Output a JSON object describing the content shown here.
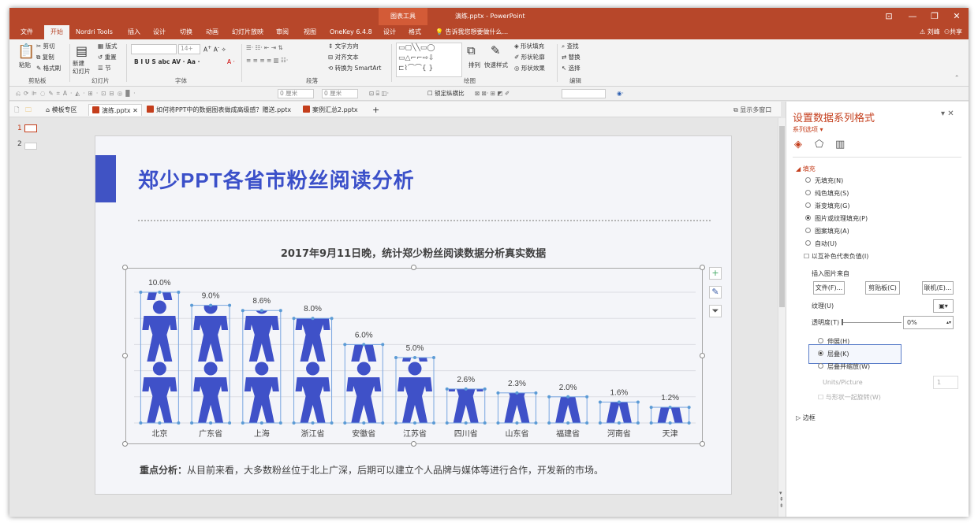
{
  "window": {
    "context_tab_group": "图表工具",
    "doc_title": "演练.pptx - PowerPoint",
    "controls": [
      "⊡",
      "—",
      "❐",
      "✕"
    ]
  },
  "ribbon_tabs": [
    "文件",
    "开始",
    "Nordri Tools",
    "插入",
    "设计",
    "切换",
    "动画",
    "幻灯片放映",
    "审阅",
    "视图",
    "OneKey 6.4.8",
    "设计",
    "格式"
  ],
  "tell_me": "告诉我您想要做什么...",
  "user": {
    "name": "刘峰",
    "share": "共享"
  },
  "ribbon": {
    "clipboard": {
      "paste": "粘贴",
      "cut": "剪切",
      "copy": "复制",
      "format_painter": "格式刷",
      "group": "剪贴板"
    },
    "slides": {
      "new_slide": "新建\n幻灯片",
      "layout": "版式",
      "reset": "重置",
      "section": "节",
      "group": "幻灯片"
    },
    "font": {
      "size": "14+",
      "group": "字体"
    },
    "paragraph": {
      "text_direction": "文字方向",
      "align_text": "对齐文本",
      "smartart": "转换为 SmartArt",
      "group": "段落"
    },
    "drawing": {
      "arrange": "排列",
      "quick_styles": "快速样式",
      "shape_fill": "形状填充",
      "shape_outline": "形状轮廓",
      "shape_effects": "形状效果",
      "group": "绘图"
    },
    "editing": {
      "find": "查找",
      "replace": "替换",
      "select": "选择",
      "group": "编辑"
    }
  },
  "qat": {
    "lock_ratio": "锁定纵横比",
    "w_value": "0 厘米",
    "h_value": "0 厘米"
  },
  "doc_tabs": [
    {
      "label": "模板专区",
      "active": false
    },
    {
      "label": "演练.pptx",
      "active": true
    },
    {
      "label": "如何将PPT中的数据图表做成高级感？赠送.pptx",
      "active": false
    },
    {
      "label": "案例汇总2.pptx",
      "active": false
    }
  ],
  "show_multi_window": "显示多窗口",
  "thumbnails": [
    "1",
    "2"
  ],
  "slide": {
    "title": "郑少PPT各省市粉丝阅读分析",
    "subtitle": "2017年9月11日晚，统计郑少粉丝阅读数据分析真实数据",
    "analysis_label": "重点分析：",
    "analysis_text": "从目前来看，大多数粉丝位于北上广深，后期可以建立个人品牌与媒体等进行合作，开发新的市场。"
  },
  "chart_data": {
    "type": "bar",
    "title": "",
    "categories": [
      "北京",
      "广东省",
      "上海",
      "浙江省",
      "安徽省",
      "江苏省",
      "四川省",
      "山东省",
      "福建省",
      "河南省",
      "天津"
    ],
    "values": [
      10.0,
      9.0,
      8.6,
      8.0,
      6.0,
      5.0,
      2.6,
      2.3,
      2.0,
      1.6,
      1.2
    ],
    "data_labels": [
      "10.0%",
      "9.0%",
      "8.6%",
      "8.0%",
      "6.0%",
      "5.0%",
      "2.6%",
      "2.3%",
      "2.0%",
      "1.6%",
      "1.2%"
    ],
    "ylim": [
      0,
      10
    ],
    "fill": "picture-stacked-person-icon",
    "color": "#3f51c8",
    "grid": true
  },
  "pane": {
    "title": "设置数据系列格式",
    "series_options": "系列选项",
    "fill_section": "填充",
    "fill_options": [
      "无填充(N)",
      "纯色填充(S)",
      "渐变填充(G)",
      "图片或纹理填充(P)",
      "图案填充(A)",
      "自动(U)"
    ],
    "selected_fill": 3,
    "invert_if_negative": "以互补色代表负值(I)",
    "insert_from": "插入图片来自",
    "btn_file": "文件(F)...",
    "btn_clipboard": "剪贴板(C)",
    "btn_online": "联机(E)...",
    "texture": "纹理(U)",
    "transparency_label": "透明度(T)",
    "transparency_value": "0%",
    "stretch_options": [
      "伸展(H)",
      "层叠(K)",
      "层叠并缩放(W)"
    ],
    "selected_stretch": 1,
    "units_label": "Units/Picture",
    "units_value": "1",
    "rotate_with_shape": "与形状一起旋转(W)",
    "border_section": "边框",
    "accent": "#c43e1c"
  }
}
